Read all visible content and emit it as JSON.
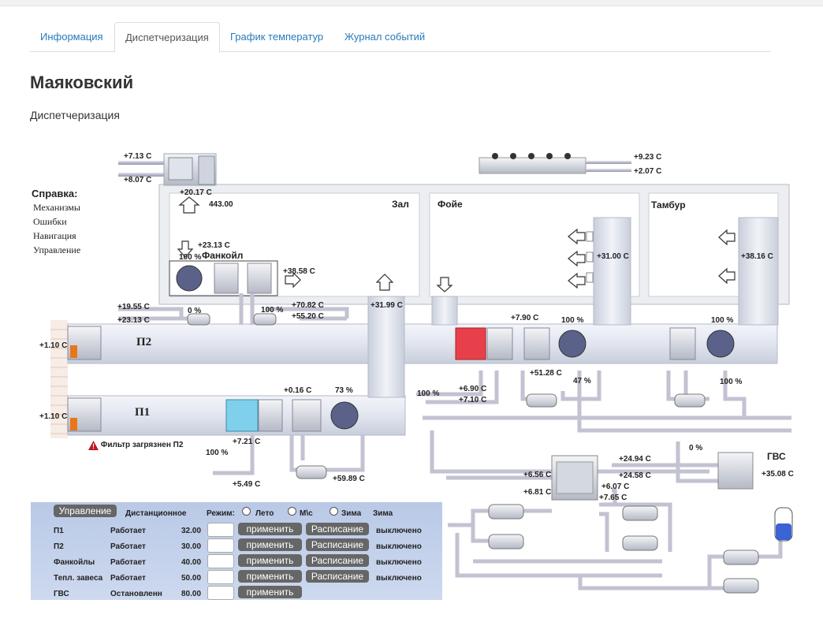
{
  "tabs": [
    "Информация",
    "Диспетчеризация",
    "График температур",
    "Журнал событий"
  ],
  "page_title": "Маяковский",
  "subtitle": "Диспетчеризация",
  "help": {
    "title": "Справка:",
    "items": [
      "Механизмы",
      "Ошибки",
      "Навигация",
      "Управление"
    ]
  },
  "rooms": {
    "hall": "Зал",
    "foyer": "Фойе",
    "tambour": "Тамбур",
    "fancoil": "Фанкойл",
    "gvs": "ГВС"
  },
  "units": {
    "p2": "П2",
    "p1": "П1"
  },
  "alarm": "Фильтр загрязнен П2",
  "readings": {
    "r1": "+7.13 C",
    "r2": "+8.07 C",
    "r3": "+20.17 C",
    "r4": "443.00",
    "r5": "+23.13 C",
    "r6": "100 %",
    "r7": "+38.58 C",
    "r8": "+19.55 C",
    "r9": "+23.13 C",
    "r10": "0 %",
    "r11": "100 %",
    "r12": "+70.82 C",
    "r13": "+55.20 C",
    "r14": "+31.99 C",
    "r15": "+9.23 C",
    "r16": "+2.07 C",
    "r17": "+31.00 C",
    "r18": "+38.16 C",
    "r19": "+7.90 C",
    "r20": "100 %",
    "r21": "100 %",
    "r22": "+1.10 C",
    "r23": "+1.10 C",
    "r24": "+51.28 C",
    "r25": "47 %",
    "r26": "100 %",
    "r27": "+6.90 C",
    "r28": "+7.10 C",
    "r29": "100 %",
    "r30": "+0.16 C",
    "r31": "73 %",
    "r32": "+7.21 C",
    "r33": "100 %",
    "r34": "+5.49 C",
    "r35": "+59.89 C",
    "r36": "0 %",
    "r37": "+24.94 C",
    "r38": "+24.58 C",
    "r39": "+6.56 C",
    "r40": "+6.07 C",
    "r41": "+6.81 C",
    "r42": "+7.65 C",
    "r43": "+35.08 C"
  },
  "control": {
    "title": "Управление",
    "remote": "Дистанционное",
    "mode": "Режим:",
    "modes": [
      "Лето",
      "М\\с",
      "Зима"
    ],
    "current_mode": "Зима",
    "apply": "применить",
    "schedule": "Расписание",
    "rows": [
      {
        "name": "П1",
        "state": "Работает",
        "value": "32.00",
        "schedule": true,
        "status": "выключено"
      },
      {
        "name": "П2",
        "state": "Работает",
        "value": "30.00",
        "schedule": true,
        "status": "выключено"
      },
      {
        "name": "Фанкойлы",
        "state": "Работает",
        "value": "40.00",
        "schedule": true,
        "status": "выключено"
      },
      {
        "name": "Тепл. завеса",
        "state": "Работает",
        "value": "50.00",
        "schedule": true,
        "status": "выключено"
      },
      {
        "name": "ГВС",
        "state": "Остановленн",
        "value": "80.00",
        "schedule": false,
        "status": ""
      }
    ]
  }
}
